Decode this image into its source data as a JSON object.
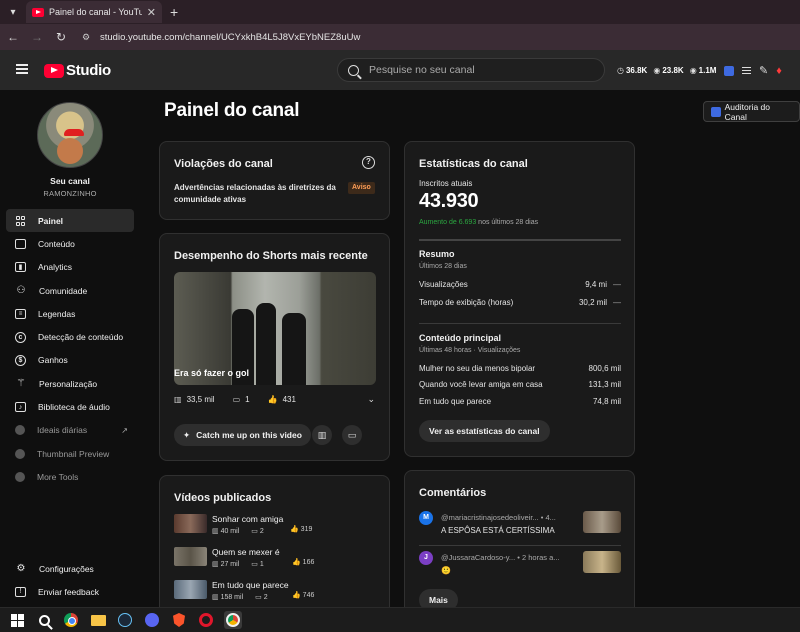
{
  "browser": {
    "tab_title": "Painel do canal - YouTube Studio",
    "url": "studio.youtube.com/channel/UCYxkhB4L5J8VxEYbNEZ8uUw"
  },
  "header": {
    "logo_text": "Studio",
    "search_placeholder": "Pesquise no seu canal",
    "stats": [
      {
        "icon": "clock-icon",
        "value": "36.8K"
      },
      {
        "icon": "eye-icon",
        "value": "23.8K"
      },
      {
        "icon": "eye-icon",
        "value": "1.1M"
      }
    ]
  },
  "sidebar": {
    "channel_caption": "Seu canal",
    "channel_name": "RAMONZINHO",
    "items": [
      {
        "label": "Painel",
        "icon": "dashboard-icon"
      },
      {
        "label": "Conteúdo",
        "icon": "content-icon"
      },
      {
        "label": "Analytics",
        "icon": "analytics-icon"
      },
      {
        "label": "Comunidade",
        "icon": "community-icon"
      },
      {
        "label": "Legendas",
        "icon": "subtitles-icon"
      },
      {
        "label": "Detecção de conteúdo",
        "icon": "copyright-icon"
      },
      {
        "label": "Ganhos",
        "icon": "earnings-icon"
      },
      {
        "label": "Personalização",
        "icon": "magic-wand-icon"
      },
      {
        "label": "Biblioteca de áudio",
        "icon": "audio-library-icon"
      },
      {
        "label": "Ideais diárias",
        "icon": "extension-icon"
      },
      {
        "label": "Thumbnail Preview",
        "icon": "extension-icon"
      },
      {
        "label": "More Tools",
        "icon": "extension-icon"
      }
    ],
    "bottom": [
      {
        "label": "Configurações",
        "icon": "gear-icon"
      },
      {
        "label": "Enviar feedback",
        "icon": "feedback-icon"
      }
    ]
  },
  "main": {
    "page_title": "Painel do canal",
    "audit_button": "Auditoria do Canal",
    "violations": {
      "title": "Violações do canal",
      "text": "Advertências relacionadas às diretrizes da comunidade ativas",
      "badge": "Aviso"
    },
    "shorts": {
      "title": "Desempenho do Shorts mais recente",
      "caption": "Era só fazer o gol",
      "views": "33,5 mil",
      "comments": "1",
      "likes": "431",
      "catch_button": "Catch me up on this video"
    },
    "published": {
      "title": "Vídeos publicados",
      "videos": [
        {
          "title": "Sonhar com amiga",
          "views": "40 mil",
          "comments": "2",
          "likes": "319"
        },
        {
          "title": "Quem se mexer é",
          "views": "27 mil",
          "comments": "1",
          "likes": "166"
        },
        {
          "title": "Em tudo que parece",
          "views": "158 mil",
          "comments": "2",
          "likes": "746"
        }
      ]
    },
    "stats_card": {
      "title": "Estatísticas do canal",
      "subs_label": "Inscritos atuais",
      "subs_value": "43.930",
      "growth_value": "Aumento de 6.693",
      "growth_suffix": "nos últimos 28 dias",
      "summary_title": "Resumo",
      "summary_sub": "Últimos 28 dias",
      "summary_rows": [
        {
          "label": "Visualizações",
          "value": "9,4 mi",
          "trend": "—"
        },
        {
          "label": "Tempo de exibição (horas)",
          "value": "30,2 mil",
          "trend": "—"
        }
      ],
      "top_title": "Conteúdo principal",
      "top_sub": "Últimas 48 horas · Visualizações",
      "top_rows": [
        {
          "label": "Mulher no seu dia menos bipolar",
          "value": "800,6 mil"
        },
        {
          "label": "Quando você levar amiga em casa",
          "value": "131,3 mil"
        },
        {
          "label": "Em tudo que parece",
          "value": "74,8 mil"
        }
      ],
      "button": "Ver as estatísticas do canal"
    },
    "comments": {
      "title": "Comentários",
      "items": [
        {
          "initial": "M",
          "author": "@mariacristinajosedeoliveir...",
          "time": "• 4...",
          "text": "A ESPÔSA ESTÁ CERTÍSSIMA",
          "color": "#1a73e8"
        },
        {
          "initial": "J",
          "author": "@JussaraCardoso-y...",
          "time": "• 2 horas a...",
          "text": "🙂",
          "color": "#7b3fc4"
        }
      ],
      "more_button": "Mais"
    }
  },
  "colors": {
    "accent_red": "#ff0033",
    "growth_green": "#2ba640",
    "warning_orange": "#ff9e57"
  }
}
